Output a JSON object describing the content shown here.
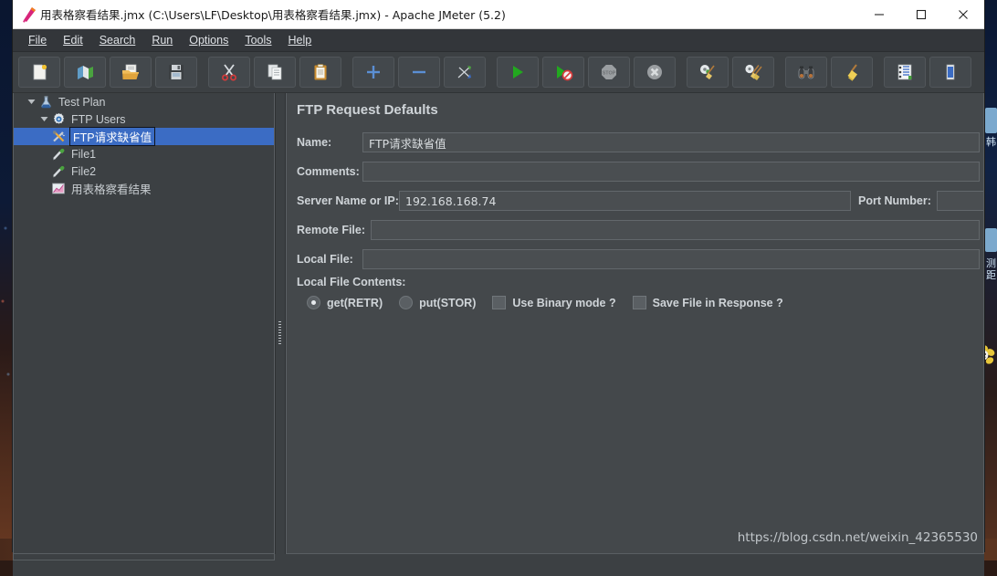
{
  "window": {
    "title": "用表格察看结果.jmx (C:\\Users\\LF\\Desktop\\用表格察看结果.jmx) - Apache JMeter (5.2)",
    "app_icon": "jmeter-logo-icon",
    "controls": {
      "minimize": "minimize-icon",
      "maximize": "maximize-icon",
      "close": "close-icon"
    }
  },
  "menubar": {
    "items": [
      {
        "label": "File",
        "mnemonic": "F"
      },
      {
        "label": "Edit",
        "mnemonic": "E"
      },
      {
        "label": "Search",
        "mnemonic": "S"
      },
      {
        "label": "Run",
        "mnemonic": "R"
      },
      {
        "label": "Options",
        "mnemonic": "O"
      },
      {
        "label": "Tools",
        "mnemonic": "T"
      },
      {
        "label": "Help",
        "mnemonic": "H"
      }
    ]
  },
  "toolbar": {
    "buttons": [
      {
        "icon": "new-document-icon",
        "tooltip": "New"
      },
      {
        "icon": "templates-icon",
        "tooltip": "Templates"
      },
      {
        "icon": "open-folder-icon",
        "tooltip": "Open"
      },
      {
        "icon": "save-floppy-icon",
        "tooltip": "Save"
      },
      {
        "icon": "cut-scissors-icon",
        "tooltip": "Cut"
      },
      {
        "icon": "copy-pages-icon",
        "tooltip": "Copy"
      },
      {
        "icon": "paste-clipboard-icon",
        "tooltip": "Paste"
      },
      {
        "icon": "plus-icon",
        "tooltip": "Expand All"
      },
      {
        "icon": "minus-icon",
        "tooltip": "Collapse All"
      },
      {
        "icon": "toggle-arrows-icon",
        "tooltip": "Toggle"
      },
      {
        "icon": "start-play-icon",
        "tooltip": "Start"
      },
      {
        "icon": "start-no-pauses-icon",
        "tooltip": "Start no pauses"
      },
      {
        "icon": "stop-sign-icon",
        "tooltip": "Stop"
      },
      {
        "icon": "shutdown-icon",
        "tooltip": "Shutdown"
      },
      {
        "icon": "clear-gear-broom-icon",
        "tooltip": "Clear"
      },
      {
        "icon": "clear-all-broom-icon",
        "tooltip": "Clear All"
      },
      {
        "icon": "search-binoculars-icon",
        "tooltip": "Search"
      },
      {
        "icon": "reset-broom-icon",
        "tooltip": "Reset Search"
      },
      {
        "icon": "function-helper-icon",
        "tooltip": "Function Helper Dialog"
      },
      {
        "icon": "heap-memory-icon",
        "tooltip": "Heap memory"
      }
    ]
  },
  "tree": {
    "nodes": [
      {
        "label": "Test Plan",
        "icon": "flask-icon",
        "depth": 0,
        "twisty": "expanded",
        "selected": false
      },
      {
        "label": "FTP Users",
        "icon": "gear-icon",
        "depth": 1,
        "twisty": "expanded",
        "selected": false
      },
      {
        "label": "FTP请求缺省值",
        "icon": "wrench-tools-icon",
        "depth": 2,
        "twisty": "none",
        "selected": true
      },
      {
        "label": "File1",
        "icon": "pipette-icon",
        "depth": 2,
        "twisty": "none",
        "selected": false
      },
      {
        "label": "File2",
        "icon": "pipette-icon",
        "depth": 2,
        "twisty": "none",
        "selected": false
      },
      {
        "label": "用表格察看结果",
        "icon": "chart-view-icon",
        "depth": 2,
        "twisty": "none",
        "selected": false
      }
    ]
  },
  "form": {
    "title": "FTP Request Defaults",
    "fields": {
      "name_label": "Name:",
      "name_value": "FTP请求缺省值",
      "comments_label": "Comments:",
      "comments_value": "",
      "server_label": "Server Name or IP:",
      "server_value": "192.168.168.74",
      "port_label": "Port Number:",
      "port_value": "",
      "remote_file_label": "Remote File:",
      "remote_file_value": "",
      "local_file_label": "Local File:",
      "local_file_value": "",
      "local_contents_label": "Local File Contents:",
      "local_contents_value": ""
    },
    "options": {
      "get_label": "get(RETR)",
      "get_selected": true,
      "put_label": "put(STOR)",
      "put_selected": false,
      "binary_label": "Use Binary mode ?",
      "binary_checked": false,
      "save_label": "Save File in Response ?",
      "save_checked": false
    }
  },
  "watermark": {
    "text": "https://blog.csdn.net/weixin_42365530"
  },
  "colors": {
    "window_bg": "#3c4043",
    "panel_bg": "#44484b",
    "titlebar_bg": "#ffffff",
    "menubar_bg": "#33363a",
    "selection_blue": "#3b6cc4",
    "text": "#cfd4d8",
    "field_bg": "#4a4e51",
    "field_border": "#62676b"
  }
}
